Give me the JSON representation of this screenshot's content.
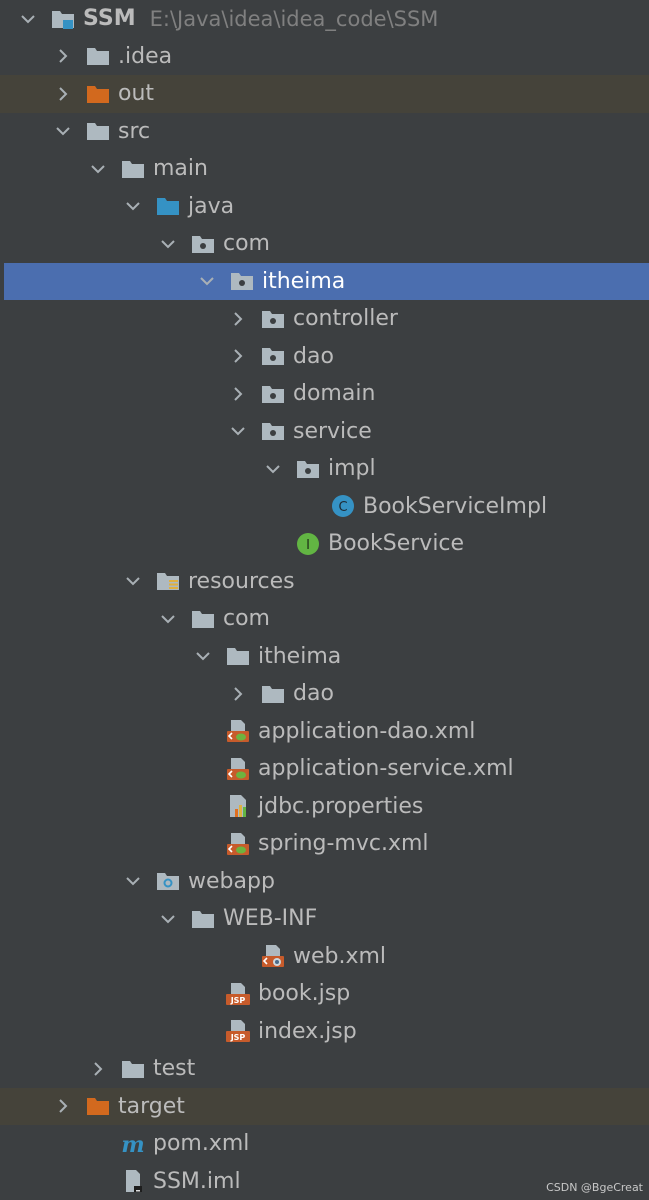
{
  "project_tree": {
    "items": [
      {
        "label": "SSM",
        "path_hint": "E:\\Java\\idea\\idea_code\\SSM",
        "icon": "project-folder-icon",
        "expanded": true,
        "depth": 0
      },
      {
        "label": ".idea",
        "icon": "folder-icon",
        "expanded": false,
        "depth": 1
      },
      {
        "label": "out",
        "icon": "excluded-folder-icon",
        "expanded": false,
        "depth": 1,
        "state": "excluded"
      },
      {
        "label": "src",
        "icon": "folder-icon",
        "expanded": true,
        "depth": 1
      },
      {
        "label": "main",
        "icon": "folder-icon",
        "expanded": true,
        "depth": 2
      },
      {
        "label": "java",
        "icon": "source-root-folder-icon",
        "expanded": true,
        "depth": 3
      },
      {
        "label": "com",
        "icon": "package-icon",
        "expanded": true,
        "depth": 4
      },
      {
        "label": "itheima",
        "icon": "package-icon",
        "expanded": true,
        "depth": 5,
        "state": "selected"
      },
      {
        "label": "controller",
        "icon": "package-icon",
        "expanded": false,
        "depth": 6
      },
      {
        "label": "dao",
        "icon": "package-icon",
        "expanded": false,
        "depth": 6
      },
      {
        "label": "domain",
        "icon": "package-icon",
        "expanded": false,
        "depth": 6
      },
      {
        "label": "service",
        "icon": "package-icon",
        "expanded": true,
        "depth": 6
      },
      {
        "label": "impl",
        "icon": "package-icon",
        "expanded": true,
        "depth": 7
      },
      {
        "label": "BookServiceImpl",
        "icon": "java-class-icon",
        "depth": 8
      },
      {
        "label": "BookService",
        "icon": "java-interface-icon",
        "depth": 7
      },
      {
        "label": "resources",
        "icon": "resources-folder-icon",
        "expanded": true,
        "depth": 3
      },
      {
        "label": "com",
        "icon": "folder-icon",
        "expanded": true,
        "depth": 4
      },
      {
        "label": "itheima",
        "icon": "folder-icon",
        "expanded": true,
        "depth": 5
      },
      {
        "label": "dao",
        "icon": "folder-icon",
        "expanded": false,
        "depth": 6
      },
      {
        "label": "application-dao.xml",
        "icon": "spring-xml-icon",
        "depth": 5
      },
      {
        "label": "application-service.xml",
        "icon": "spring-xml-icon",
        "depth": 5
      },
      {
        "label": "jdbc.properties",
        "icon": "properties-file-icon",
        "depth": 5
      },
      {
        "label": "spring-mvc.xml",
        "icon": "spring-xml-icon",
        "depth": 5
      },
      {
        "label": "webapp",
        "icon": "web-folder-icon",
        "expanded": true,
        "depth": 3
      },
      {
        "label": "WEB-INF",
        "icon": "folder-icon",
        "expanded": true,
        "depth": 4
      },
      {
        "label": "web.xml",
        "icon": "web-xml-icon",
        "depth": 6
      },
      {
        "label": "book.jsp",
        "icon": "jsp-file-icon",
        "depth": 5
      },
      {
        "label": "index.jsp",
        "icon": "jsp-file-icon",
        "depth": 5
      },
      {
        "label": "test",
        "icon": "folder-icon",
        "expanded": false,
        "depth": 2
      },
      {
        "label": "target",
        "icon": "excluded-folder-icon",
        "expanded": false,
        "depth": 1,
        "state": "excluded"
      },
      {
        "label": "pom.xml",
        "icon": "maven-file-icon",
        "depth": 2
      },
      {
        "label": "SSM.iml",
        "icon": "iml-file-icon",
        "depth": 2
      }
    ]
  },
  "watermark": "CSDN @BgeCreat",
  "colors": {
    "background": "#3c3f41",
    "selection": "#4b6eaf",
    "excluded_row": "#45433a",
    "text": "#bbbbbb",
    "folder": "#aeb9c0",
    "source_folder": "#3592c4",
    "excluded_folder": "#d2691e",
    "java_class": "#3592c4",
    "java_interface": "#62b543"
  }
}
